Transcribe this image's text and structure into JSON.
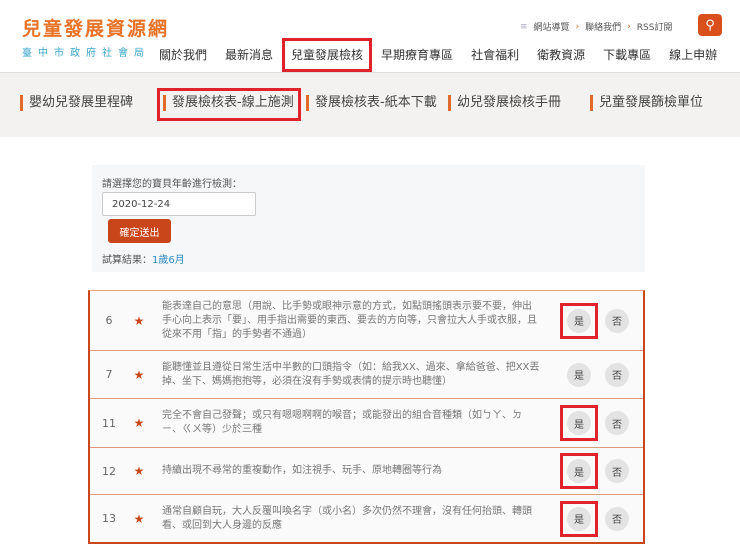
{
  "logo": {
    "title": "兒童發展資源網",
    "subtitle": "臺中市政府社會局"
  },
  "toplinks": [
    "網站導覽",
    "聯絡我們",
    "RSS訂閱"
  ],
  "nav": [
    "關於我們",
    "最新消息",
    "兒童發展檢核",
    "早期療育專區",
    "社會福利",
    "衛教資源",
    "下載專區",
    "線上申辦"
  ],
  "subnav": [
    "嬰幼兒發展里程碑",
    "發展檢核表-線上施測",
    "發展檢核表-紙本下載",
    "幼兒發展檢核手冊",
    "兒童發展篩檢單位"
  ],
  "form": {
    "label": "請選擇您的寶貝年齡進行檢測：",
    "date": "2020-12-24",
    "submit": "確定送出",
    "result_label": "試算結果：",
    "result_value": "1歲6月"
  },
  "yes": "是",
  "no": "否",
  "rows": [
    {
      "n": "6",
      "q": "能表達自己的意思（用說、比手勢或眼神示意的方式，如點頭搖頭表示要不要，伸出手心向上表示「要」、用手指出需要的東西、要去的方向等，只會拉大人手或衣服，且從來不用「指」的手勢者不通過）"
    },
    {
      "n": "7",
      "q": "能聽懂並且遵從日常生活中半數的口頭指令（如：給我XX、過來、拿給爸爸、把XX丟掉、坐下、媽媽抱抱等，必須在沒有手勢或表情的提示時也聽懂）"
    },
    {
      "n": "11",
      "q": "完全不會自己發聲；或只有嗯嗯啊啊的喉音；或能發出的組合音種類（如ㄅㄚ、ㄉㄧ、ㄍㄨ等）少於三種"
    },
    {
      "n": "12",
      "q": "持續出現不尋常的重複動作，如注視手、玩手、原地轉圈等行為"
    },
    {
      "n": "13",
      "q": "通常自顧自玩，大人反覆叫喚名字（或小名）多次仍然不理會，沒有任何抬頭、轉頭看、或回到大人身邊的反應"
    }
  ]
}
